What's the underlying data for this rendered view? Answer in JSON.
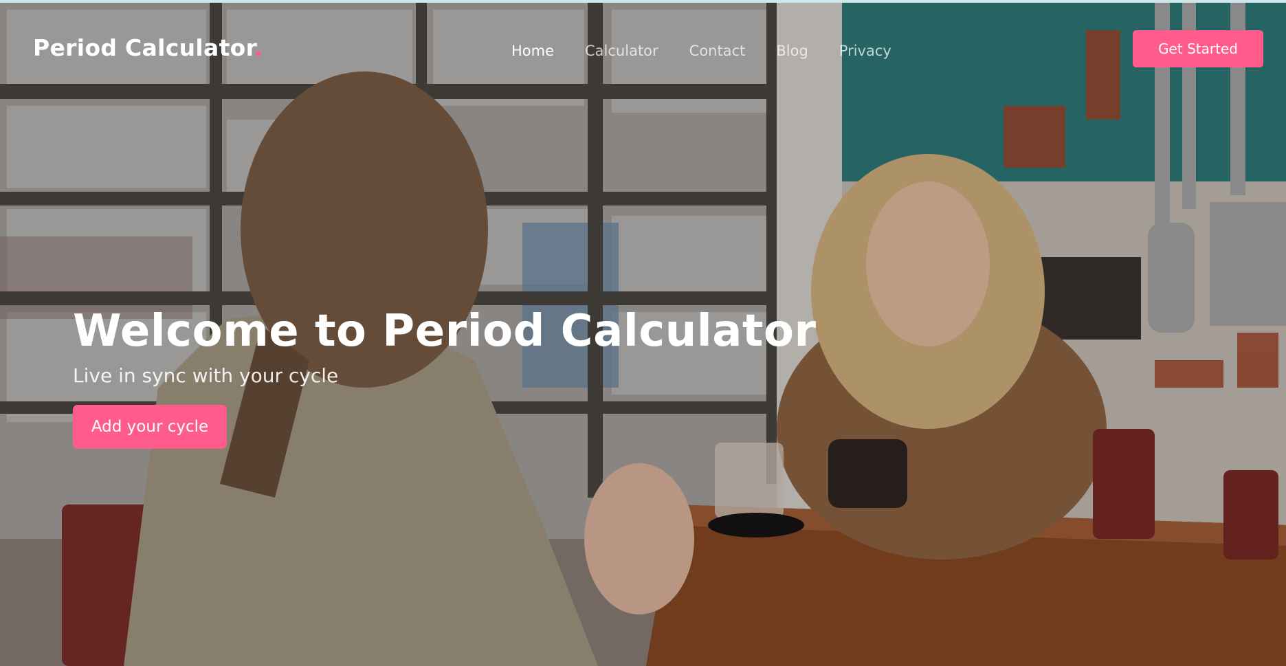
{
  "brand": {
    "name": "Period Calculator",
    "dot": ".",
    "accent_color": "#ff5c8d"
  },
  "nav": {
    "items": [
      {
        "label": "Home",
        "active": true
      },
      {
        "label": "Calculator",
        "active": false
      },
      {
        "label": "Contact",
        "active": false
      },
      {
        "label": "Blog",
        "active": false
      },
      {
        "label": "Privacy",
        "active": false
      }
    ],
    "cta_label": "Get Started"
  },
  "hero": {
    "title": "Welcome to Period Calculator",
    "subtitle": "Live in sync with your cycle",
    "button_label": "Add your cycle",
    "background": "photo of two women sitting at a cafe table by a window, one holding a phone"
  }
}
